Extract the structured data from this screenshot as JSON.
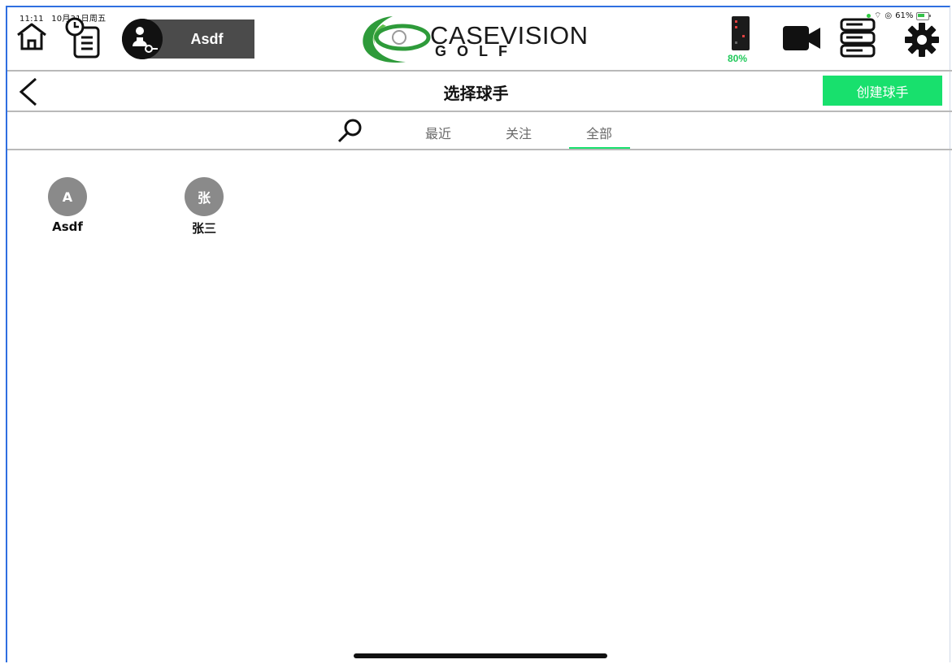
{
  "status": {
    "time": "11:11",
    "date": "10月31日周五",
    "battery": "61%"
  },
  "header": {
    "user_name": "Asdf",
    "brand_title": "CASEVISION",
    "brand_subtitle": "GOLF",
    "device_battery": "80%",
    "icons": [
      "home-icon",
      "history-icon",
      "user-key-icon",
      "device-icon",
      "camera-icon",
      "server-icon",
      "gear-icon"
    ]
  },
  "page": {
    "title": "选择球手",
    "back_label": "",
    "create_button": "创建球手"
  },
  "tabs": [
    "最近",
    "关注",
    "全部"
  ],
  "active_tab": "全部",
  "players": [
    {
      "initial": "A",
      "name": "Asdf"
    },
    {
      "initial": "张",
      "name": "张三"
    }
  ],
  "colors": {
    "accent": "#18e06d",
    "battery_text": "#20c95a",
    "avatar": "#8a8a8a",
    "user_box": "#4b4b4b"
  }
}
